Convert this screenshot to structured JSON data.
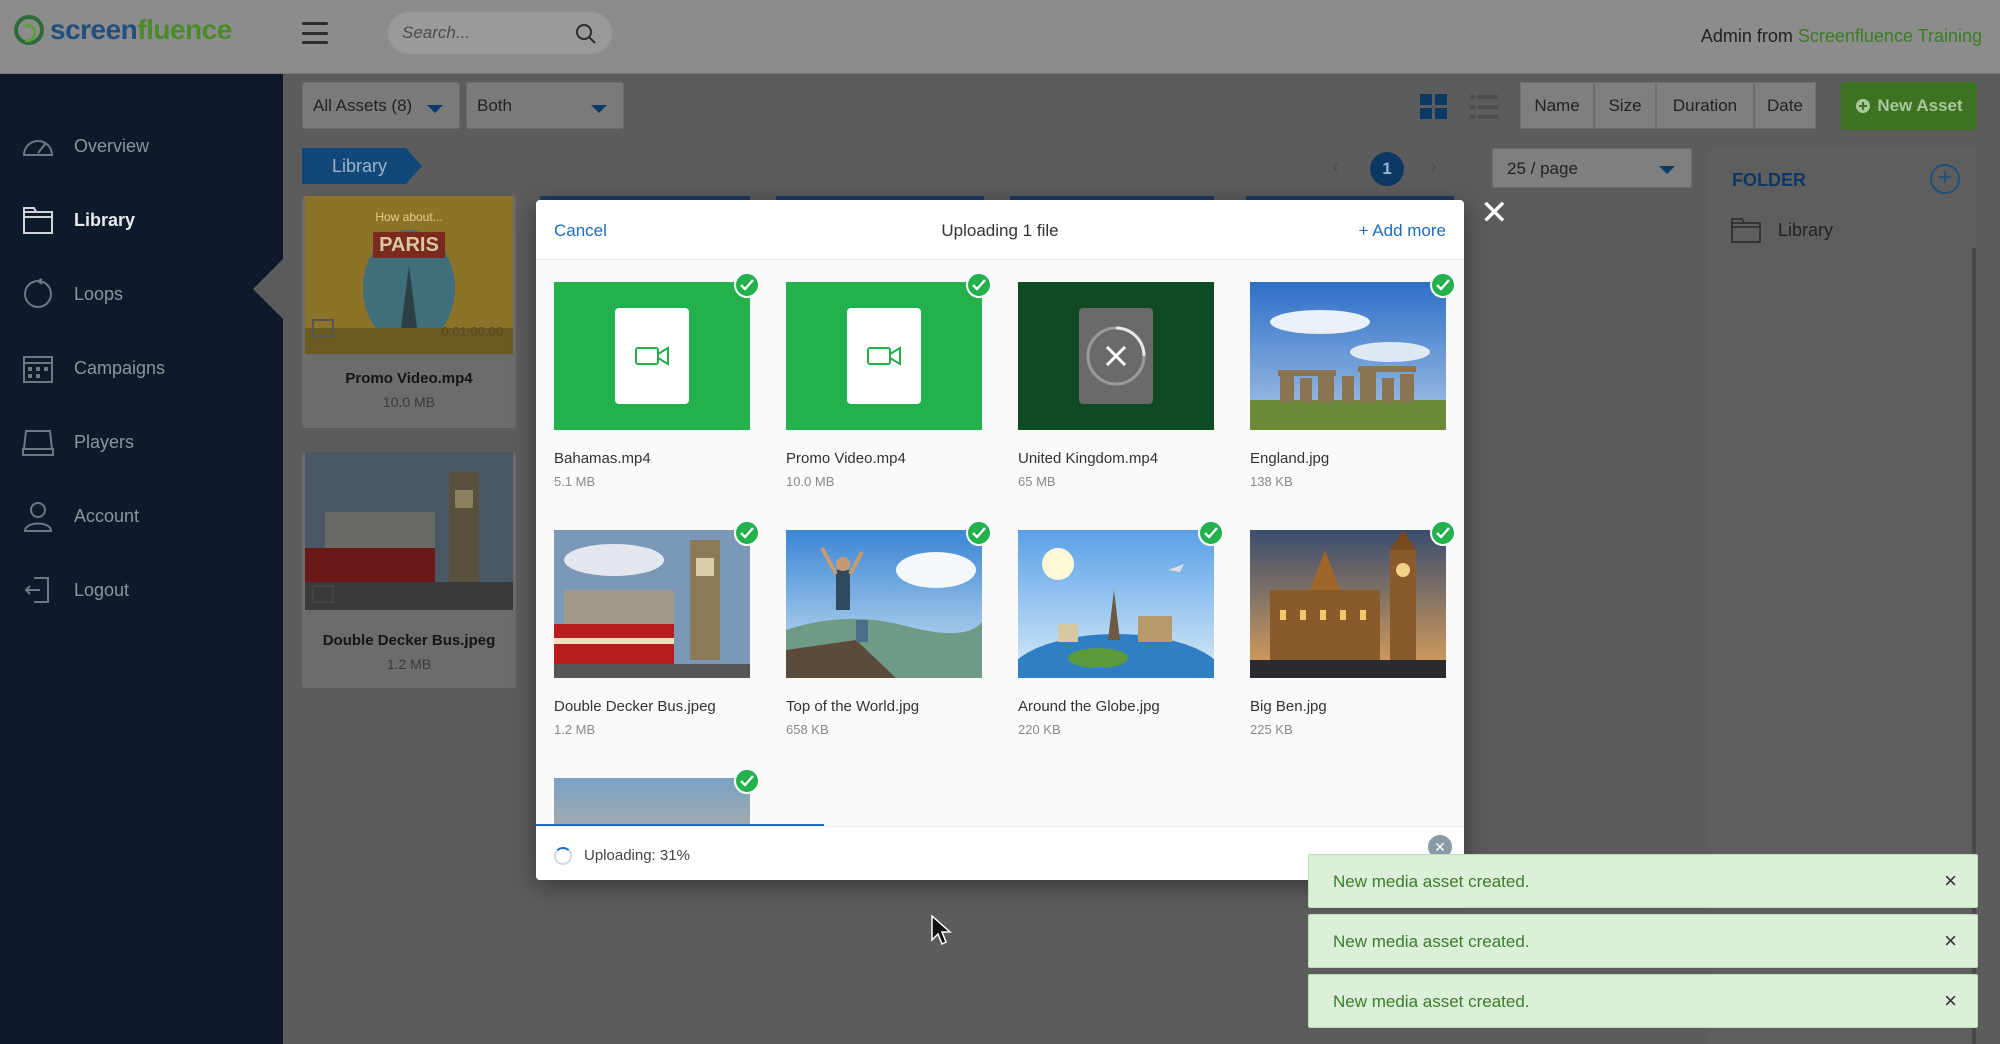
{
  "header": {
    "logo_text_a": "screen",
    "logo_text_b": "fluence",
    "search_placeholder": "Search...",
    "user_name": "Admin",
    "user_from": "from",
    "user_org": "Screenfluence Training"
  },
  "sidebar": {
    "items": [
      {
        "label": "Overview",
        "icon": "gauge-icon"
      },
      {
        "label": "Library",
        "icon": "folder-icon",
        "active": true
      },
      {
        "label": "Loops",
        "icon": "loop-icon"
      },
      {
        "label": "Campaigns",
        "icon": "calendar-icon"
      },
      {
        "label": "Players",
        "icon": "player-icon"
      },
      {
        "label": "Account",
        "icon": "user-icon"
      },
      {
        "label": "Logout",
        "icon": "logout-icon"
      }
    ]
  },
  "toolbar": {
    "filter_assets": "All Assets (8)",
    "filter_type": "Both",
    "sort": [
      "Name",
      "Size",
      "Duration",
      "Date"
    ],
    "new_asset": "New Asset"
  },
  "breadcrumb": "Library",
  "pager": {
    "prev": "‹",
    "current": "1",
    "next": "›",
    "per_page": "25 / page"
  },
  "folder_panel": {
    "title": "FOLDER",
    "add": "+",
    "items": [
      "Library"
    ]
  },
  "library_cards": [
    {
      "name": "Promo Video.mp4",
      "size": "10.0 MB",
      "duration": "0:01:00.00",
      "overlay_top": "How about...",
      "overlay_word": "PARIS"
    },
    {
      "name": "Double Decker Bus.jpeg",
      "size": "1.2 MB"
    }
  ],
  "upload_modal": {
    "cancel": "Cancel",
    "title": "Uploading 1 file",
    "add_more": "Add more",
    "files": [
      {
        "name": "Bahamas.mp4",
        "size": "5.1 MB"
      },
      {
        "name": "Promo Video.mp4",
        "size": "10.0 MB"
      },
      {
        "name": "United Kingdom.mp4",
        "size": "65 MB"
      },
      {
        "name": "England.jpg",
        "size": "138 KB"
      },
      {
        "name": "Double Decker Bus.jpeg",
        "size": "1.2 MB"
      },
      {
        "name": "Top of the World.jpg",
        "size": "658 KB"
      },
      {
        "name": "Around the Globe.jpg",
        "size": "220 KB"
      },
      {
        "name": "Big Ben.jpg",
        "size": "225 KB"
      }
    ],
    "status": "Uploading: 31%",
    "progress": 0.31
  },
  "toasts": [
    "New media asset created.",
    "New media asset created.",
    "New media asset created."
  ],
  "colors": {
    "brand_green": "#4a8a2b",
    "brand_blue": "#1f4f7a",
    "upload_check": "#22b14c",
    "link_blue": "#1a6dc0",
    "sidebar_bg": "#0e1a2b"
  }
}
